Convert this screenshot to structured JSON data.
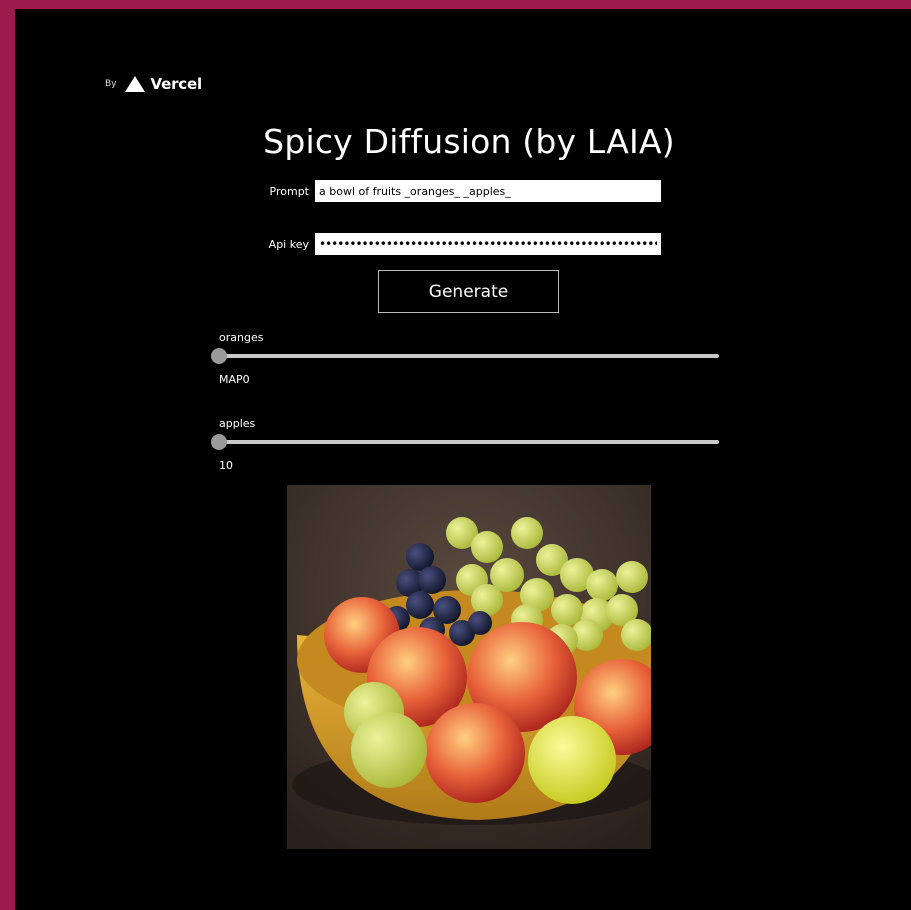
{
  "brand": {
    "by_text": "By",
    "name": "Vercel"
  },
  "title": "Spicy Diffusion (by LAIA)",
  "form": {
    "prompt_label": "Prompt",
    "prompt_value": "a bowl of fruits _oranges_ _apples_",
    "apikey_label": "Api key",
    "apikey_value": "••••••••••••••••••••••••••••••••••••••••••••••••••••••••",
    "generate_label": "Generate"
  },
  "sliders": [
    {
      "label": "oranges",
      "value_text": "MAP0",
      "position": 0
    },
    {
      "label": "apples",
      "value_text": "10",
      "position": 0
    }
  ],
  "colors": {
    "border": "#9c1b4a",
    "background": "#000000",
    "track": "#c8c8c8",
    "thumb": "#9a9a9a"
  }
}
